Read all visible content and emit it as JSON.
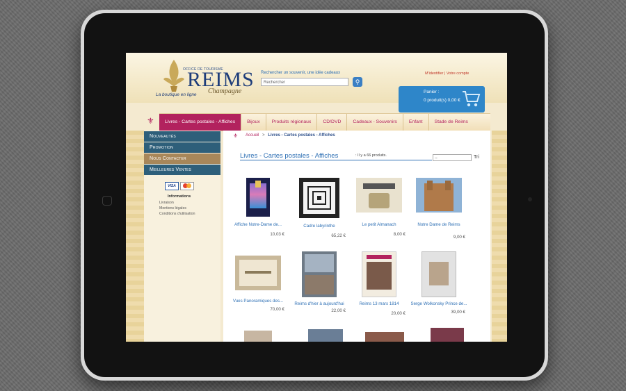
{
  "header": {
    "logo_small": "OFFICE DE TOURISME",
    "logo_main": "REIMS",
    "logo_script": "Champagne",
    "logo_tagline": "La boutique en ligne",
    "search_label": "Rechercher un souvenir, une idée cadeaux",
    "search_placeholder": "Rechercher",
    "account_link": "M'identifier | Votre compte",
    "cart_label": "Panier :",
    "cart_count": "0 produit(s) 0,00 €"
  },
  "nav": {
    "items": [
      {
        "label": "Livres - Cartes postales - Affiches"
      },
      {
        "label": "Bijoux"
      },
      {
        "label": "Produits régionaux"
      },
      {
        "label": "CD/DVD"
      },
      {
        "label": "Cadeaux - Souvenirs"
      },
      {
        "label": "Enfant"
      },
      {
        "label": "Stade de Reims"
      }
    ]
  },
  "sidebar": {
    "menu": [
      {
        "label": "Nouveautés",
        "color": "#2e5f7a"
      },
      {
        "label": "Promotion",
        "color": "#2e5f7a"
      },
      {
        "label": "Nous Contacter",
        "color": "#a8875a"
      },
      {
        "label": "Meilleures Ventes",
        "color": "#2e5f7a"
      }
    ],
    "payment": {
      "visa": "VISA"
    },
    "info_title": "Informations",
    "info_links": [
      "Livraison",
      "Mentions légales",
      "Conditions d'utilisation"
    ]
  },
  "content": {
    "breadcrumb_home": "Accueil",
    "breadcrumb_sep": ">",
    "breadcrumb_current": "Livres - Cartes postales - Affiches",
    "title": "Livres - Cartes postales - Affiches",
    "count": ": Il y a 66 produits.",
    "sort_value": "--",
    "sort_label": "Tri",
    "products": [
      {
        "name": "Affiche Notre-Dame de...",
        "price": "10,03 €"
      },
      {
        "name": "Cadre labyrinthe",
        "price": "65,22 €"
      },
      {
        "name": "Le petit Almanach",
        "price": "8,00 €"
      },
      {
        "name": "Notre Dame de Reims",
        "price": "9,00 €"
      },
      {
        "name": "Vues Panoramiques des...",
        "price": "70,00 €"
      },
      {
        "name": "Reims d'hier à aujourd'hui",
        "price": "22,00 €"
      },
      {
        "name": "Reims 13 mars 1814",
        "price": "20,00 €"
      },
      {
        "name": "Serge Wolkonsky Prince de...",
        "price": "39,00 €"
      }
    ]
  },
  "colors": {
    "accent": "#b2225e",
    "link": "#2d6fb4",
    "cart": "#2e86c9"
  }
}
